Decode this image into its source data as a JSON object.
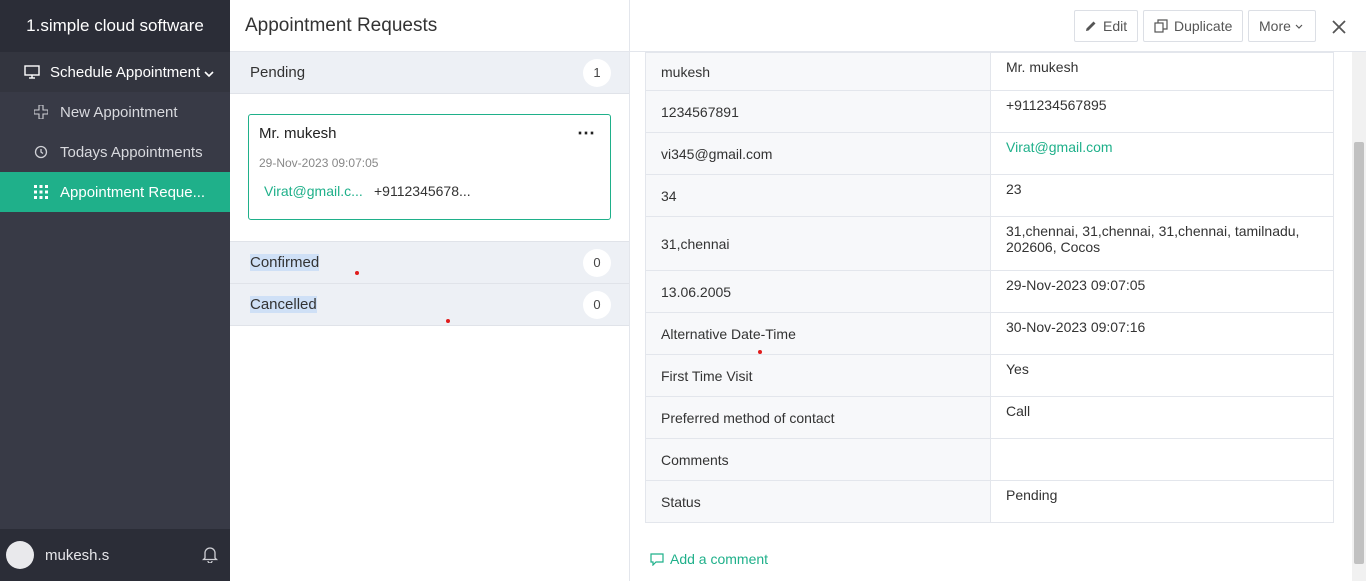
{
  "app": {
    "title": "1.simple cloud software"
  },
  "sidebar": {
    "group": {
      "label": "Schedule Appointment"
    },
    "items": [
      {
        "label": "New Appointment"
      },
      {
        "label": "Todays Appointments"
      },
      {
        "label": "Appointment Reque..."
      }
    ],
    "user": {
      "name": "mukesh.s"
    }
  },
  "middle": {
    "title": "Appointment Requests",
    "groups": [
      {
        "label": "Pending",
        "count": "1"
      },
      {
        "label": "Confirmed",
        "count": "0"
      },
      {
        "label": "Cancelled",
        "count": "0"
      }
    ],
    "card": {
      "name": "Mr. mukesh",
      "datetime": "29-Nov-2023 09:07:05",
      "email": "Virat@gmail.c...",
      "phone": "+9112345678..."
    }
  },
  "detail": {
    "toolbar": {
      "edit": "Edit",
      "duplicate": "Duplicate",
      "more": "More"
    },
    "rows": [
      {
        "key": "mukesh",
        "value": "Mr. mukesh"
      },
      {
        "key": "1234567891",
        "value": "+911234567895"
      },
      {
        "key": "vi345@gmail.com",
        "value": "Virat@gmail.com"
      },
      {
        "key": "34",
        "value": "23"
      },
      {
        "key": "31,chennai",
        "value": "31,chennai, 31,chennai, 31,chennai, tamilnadu, 202606, Cocos"
      },
      {
        "key": "13.06.2005",
        "value": "29-Nov-2023 09:07:05"
      },
      {
        "key": "Alternative Date-Time",
        "value": "30-Nov-2023 09:07:16"
      },
      {
        "key": "First Time Visit",
        "value": "Yes"
      },
      {
        "key": "Preferred method of contact",
        "value": "Call"
      },
      {
        "key": "Comments",
        "value": ""
      },
      {
        "key": "Status",
        "value": "Pending"
      }
    ],
    "add_comment": "Add a comment"
  },
  "colors": {
    "accent": "#1fb08a",
    "sidebar": "#383a46",
    "sidebar_dark": "#2b2d37"
  }
}
